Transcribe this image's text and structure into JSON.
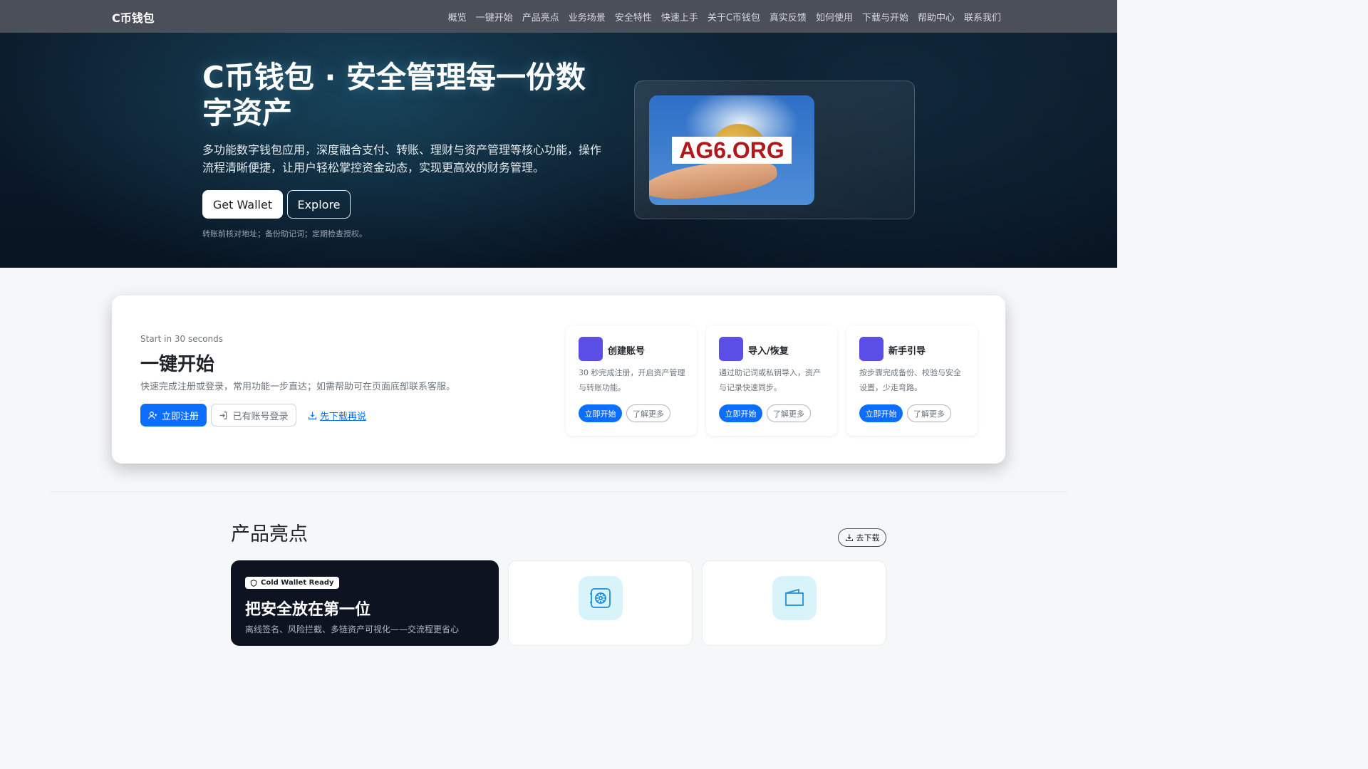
{
  "nav": {
    "brand": "C币钱包",
    "links": [
      "概览",
      "一键开始",
      "产品亮点",
      "业务场景",
      "安全特性",
      "快速上手",
      "关于C币钱包",
      "真实反馈",
      "如何使用",
      "下载与开始",
      "帮助中心",
      "联系我们"
    ]
  },
  "hero": {
    "title": "C币钱包 · 安全管理每一份数字资产",
    "description": "多功能数字钱包应用，深度融合支付、转账、理财与资产管理等核心功能，操作流程清晰便捷，让用户轻松掌控资金动态，实现更高效的财务管理。",
    "primary_button": "Get Wallet",
    "secondary_button": "Explore",
    "tip": "转账前核对地址；备份助记词；定期检查授权。",
    "image_watermark": "AG6.ORG"
  },
  "quick_start": {
    "kicker": "Start in 30 seconds",
    "title": "一键开始",
    "description": "快速完成注册或登录，常用功能一步直达；如需帮助可在页面底部联系客服。",
    "register_button": "立即注册",
    "login_button": "已有账号登录",
    "download_link": "先下载再说",
    "cards": [
      {
        "title": "创建账号",
        "description": "30 秒完成注册，开启资产管理与转账功能。",
        "go": "立即开始",
        "more": "了解更多"
      },
      {
        "title": "导入/恢复",
        "description": "通过助记词或私钥导入，资产与记录快速同步。",
        "go": "立即开始",
        "more": "了解更多"
      },
      {
        "title": "新手引导",
        "description": "按步骤完成备份、校验与安全设置，少走弯路。",
        "go": "立即开始",
        "more": "了解更多"
      }
    ]
  },
  "highlights": {
    "title": "产品亮点",
    "download_button": "去下载",
    "featured": {
      "badge": "Cold Wallet Ready",
      "title": "把安全放在第一位",
      "subtitle": "离线签名、风险拦截、多链资产可视化——交流程更省心"
    },
    "feature_icons": [
      "safe-icon",
      "wallet-icon"
    ]
  },
  "colors": {
    "nav_bg": "#4a4f5a",
    "hero_bg": "#0c1c2c",
    "primary": "#0d6efd",
    "accent_square": "#5a4ee6",
    "feature_icon_bg": "#d9f3fb",
    "dark_card": "#0d1320"
  }
}
